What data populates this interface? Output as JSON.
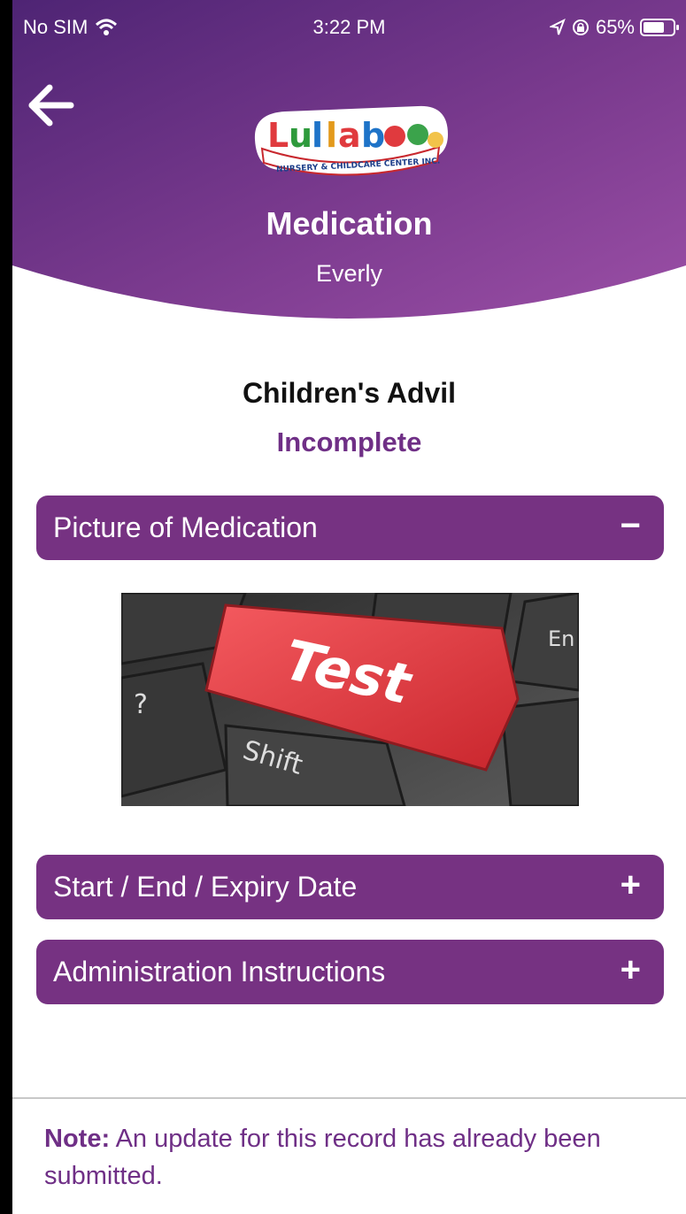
{
  "status_bar": {
    "carrier": "No SIM",
    "time": "3:22 PM",
    "battery": "65%",
    "icons": [
      "wifi-icon",
      "location-arrow-icon",
      "rotation-lock-icon",
      "battery-icon"
    ]
  },
  "header": {
    "back_icon": "arrow-left-icon",
    "logo": {
      "name": "Lullaboo",
      "tagline": "NURSERY & CHILDCARE CENTER INC."
    },
    "title": "Medication",
    "subtitle": "Everly"
  },
  "medication": {
    "name": "Children's Advil",
    "status": "Incomplete"
  },
  "sections": [
    {
      "label": "Picture of Medication",
      "toggle": "−",
      "expanded": true
    },
    {
      "label": "Start / End / Expiry Date",
      "toggle": "+",
      "expanded": false
    },
    {
      "label": "Administration Instructions",
      "toggle": "+",
      "expanded": false
    }
  ],
  "photo": {
    "key_text": "Test",
    "shift_text": "Shift",
    "question_text": "?",
    "enter_text": "En"
  },
  "note": {
    "label": "Note:",
    "text": " An update for this record has already been submitted."
  },
  "colors": {
    "primary": "#763282",
    "header_top": "#5a2a7f",
    "header_bottom": "#9a4aa4"
  }
}
